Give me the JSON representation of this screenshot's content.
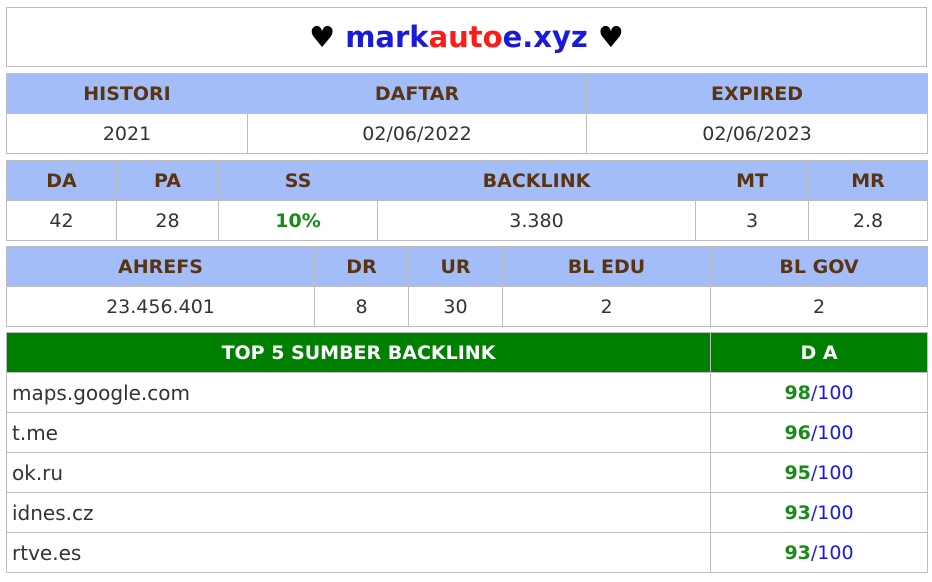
{
  "title": {
    "heart_left": "♥",
    "parts": [
      "mark",
      "auto",
      "e.xyz"
    ],
    "heart_right": "♥",
    "colors": {
      "primary": "#1a1adb",
      "accent": "#ff1a1a"
    }
  },
  "dates": {
    "headers": [
      "HISTORI",
      "DAFTAR",
      "EXPIRED"
    ],
    "values": [
      "2021",
      "02/06/2022",
      "02/06/2023"
    ]
  },
  "moz": {
    "headers": [
      "DA",
      "PA",
      "SS",
      "BACKLINK",
      "MT",
      "MR"
    ],
    "values": [
      "42",
      "28",
      "10%",
      "3.380",
      "3",
      "2.8"
    ]
  },
  "ahrefs": {
    "headers": [
      "AHREFS",
      "DR",
      "UR",
      "BL EDU",
      "BL GOV"
    ],
    "values": [
      "23.456.401",
      "8",
      "30",
      "2",
      "2"
    ]
  },
  "top_backlinks": {
    "header_source": "TOP 5 SUMBER BACKLINK",
    "header_da": "D A",
    "slash": "/",
    "rows": [
      {
        "domain": "maps.google.com",
        "da": "98",
        "max": "100"
      },
      {
        "domain": "t.me",
        "da": "96",
        "max": "100"
      },
      {
        "domain": "ok.ru",
        "da": "95",
        "max": "100"
      },
      {
        "domain": "idnes.cz",
        "da": "93",
        "max": "100"
      },
      {
        "domain": "rtve.es",
        "da": "93",
        "max": "100"
      }
    ]
  },
  "colors": {
    "header_bg": "#a3bdf8",
    "header_text": "#5a3410",
    "top_header_bg": "#008000",
    "good_value": "#1a8a1a",
    "link_blue": "#1a1adb"
  }
}
